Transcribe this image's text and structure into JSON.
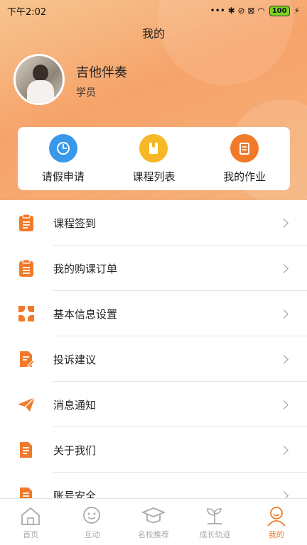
{
  "status": {
    "time": "下午2:02",
    "icons": "••• ✱ ⊘ ⊠ ◠",
    "battery": "100"
  },
  "header": {
    "title": "我的"
  },
  "user": {
    "name": "吉他伴奏",
    "role": "学员"
  },
  "quick": [
    {
      "label": "请假申请",
      "icon": "clock-icon",
      "color": "#3a98ea"
    },
    {
      "label": "课程列表",
      "icon": "book-icon",
      "color": "#f6b826"
    },
    {
      "label": "我的作业",
      "icon": "homework-icon",
      "color": "#f07a2a"
    }
  ],
  "menu": [
    {
      "label": "课程签到",
      "icon": "clipboard-icon"
    },
    {
      "label": "我的购课订单",
      "icon": "order-icon"
    },
    {
      "label": "基本信息设置",
      "icon": "settings-icon"
    },
    {
      "label": "投诉建议",
      "icon": "edit-document-icon"
    },
    {
      "label": "消息通知",
      "icon": "paper-plane-icon"
    },
    {
      "label": "关于我们",
      "icon": "document-icon"
    },
    {
      "label": "账号安全",
      "icon": "document-icon"
    }
  ],
  "tabs": [
    {
      "label": "首页",
      "icon": "home-icon"
    },
    {
      "label": "互动",
      "icon": "chat-icon"
    },
    {
      "label": "名校推荐",
      "icon": "graduation-cap-icon"
    },
    {
      "label": "成长轨迹",
      "icon": "sprout-icon"
    },
    {
      "label": "我的",
      "icon": "person-icon",
      "active": true
    }
  ],
  "colors": {
    "accent": "#f07a2a",
    "header_start": "#f7c590",
    "header_end": "#f6a36a"
  }
}
